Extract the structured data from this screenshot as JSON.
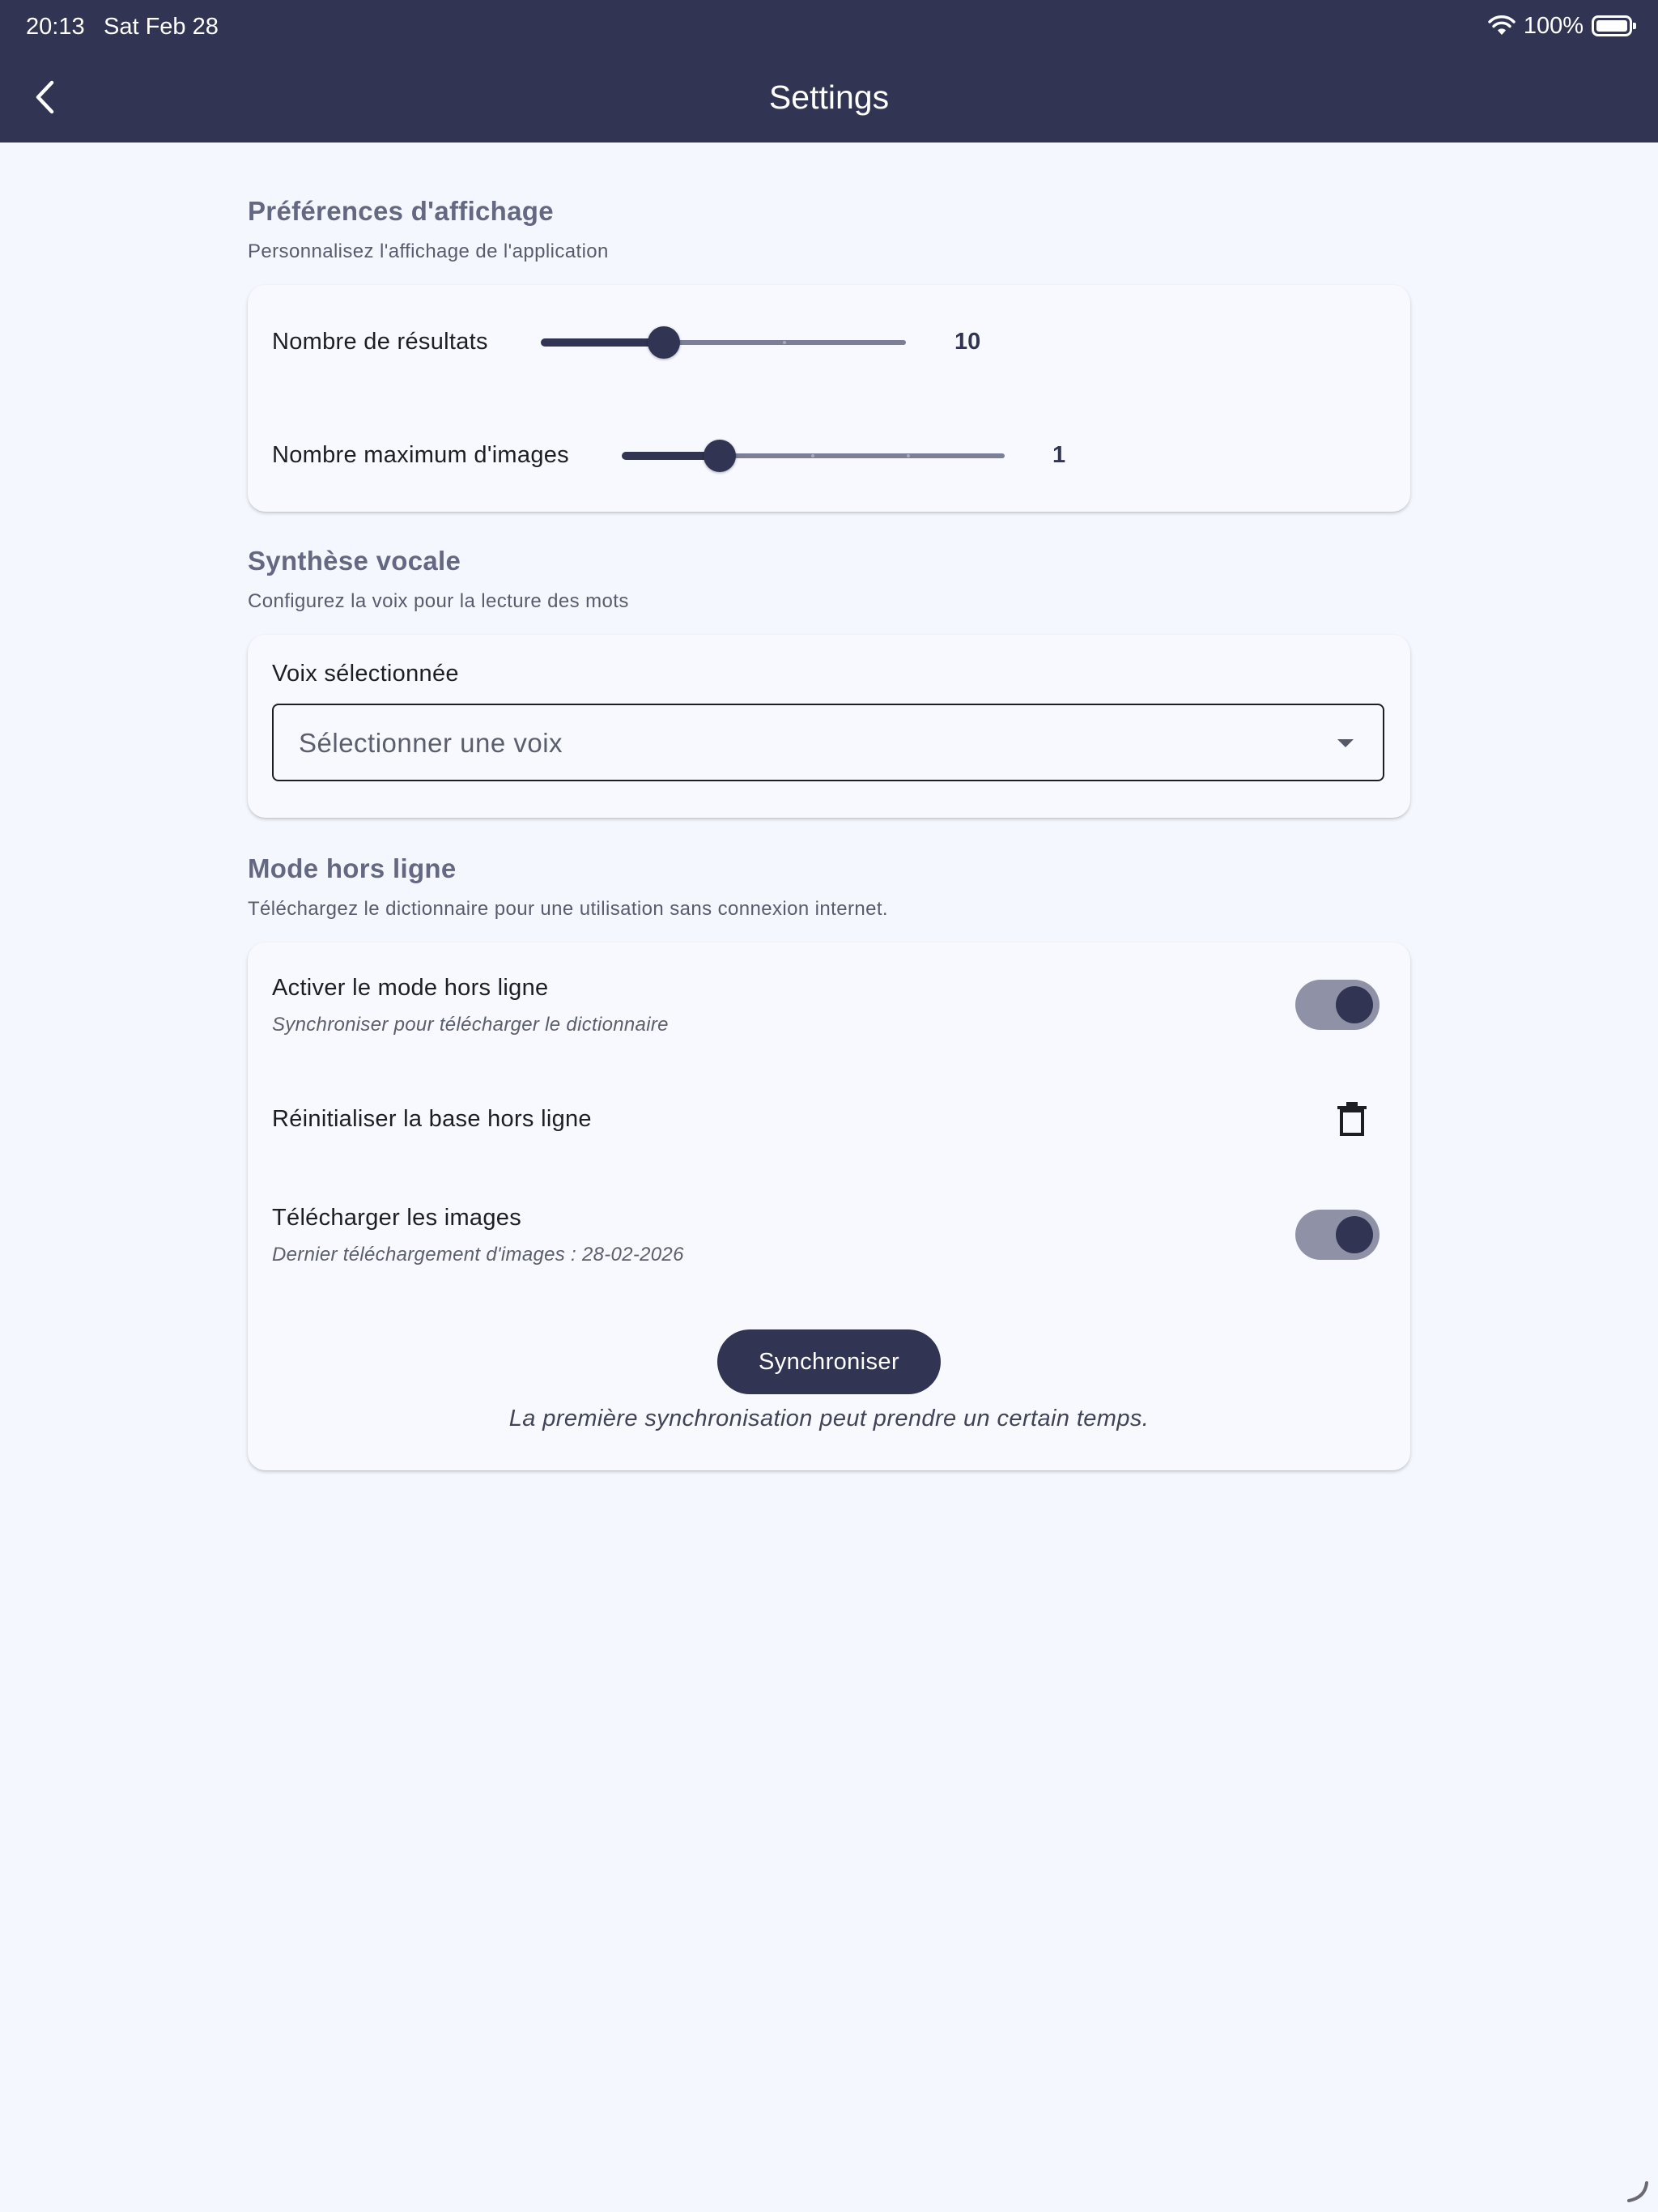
{
  "status_bar": {
    "time": "20:13",
    "date": "Sat Feb 28",
    "battery": "100%",
    "icons": [
      "wifi-icon",
      "battery-icon"
    ]
  },
  "header": {
    "title": "Settings",
    "back_icon": "chevron-left-icon"
  },
  "display_prefs": {
    "title": "Préférences d'affichage",
    "subtitle": "Personnalisez l'affichage de l'application",
    "results": {
      "label": "Nombre de résultats",
      "value": "10",
      "fraction": 0.33
    },
    "images": {
      "label": "Nombre maximum d'images",
      "value": "1",
      "fraction": 0.25
    }
  },
  "voice": {
    "title": "Synthèse vocale",
    "subtitle": "Configurez la voix pour la lecture des mots",
    "label": "Voix sélectionnée",
    "placeholder": "Sélectionner une voix"
  },
  "offline": {
    "title": "Mode hors ligne",
    "subtitle": "Téléchargez le dictionnaire pour une utilisation sans connexion internet.",
    "enable_label": "Activer le mode hors ligne",
    "enable_sub": "Synchroniser pour télécharger le dictionnaire",
    "enable_on": true,
    "reset_label": "Réinitialiser la base hors ligne",
    "reset_icon": "trash-icon",
    "images_label": "Télécharger les images",
    "images_sub": "Dernier téléchargement d'images : 28-02-2026",
    "images_on": true,
    "sync_button": "Synchroniser",
    "sync_note": "La première synchronisation peut prendre un certain temps."
  },
  "colors": {
    "primary": "#313452",
    "background": "#f5f7fe",
    "card": "#f8f9fe",
    "section_title": "#646882"
  }
}
